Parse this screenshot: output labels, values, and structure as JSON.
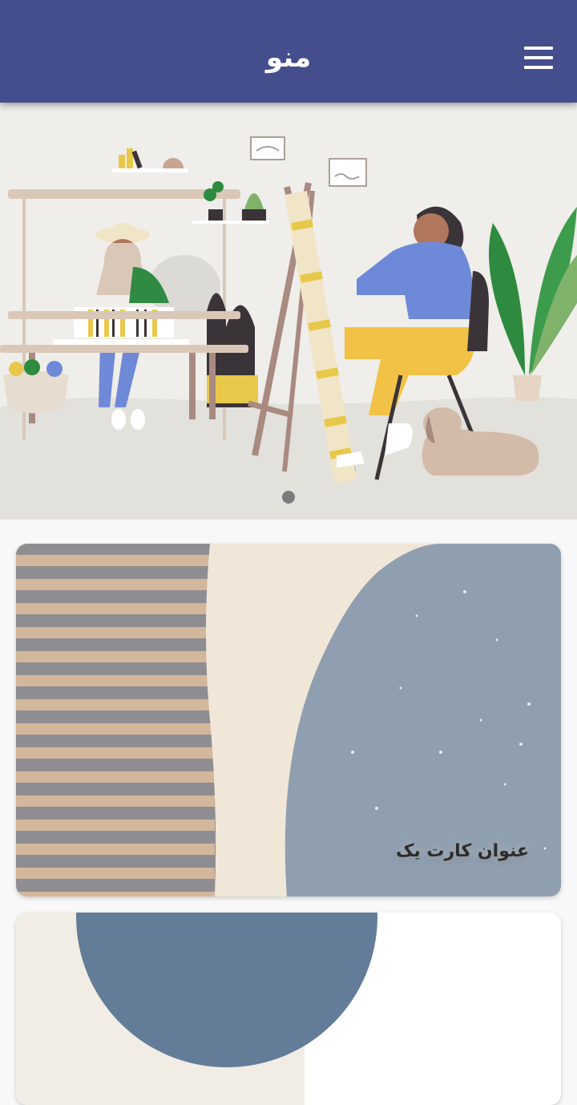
{
  "appbar": {
    "title": "منو",
    "menu_icon": "hamburger-menu-icon",
    "background": "#454e8c"
  },
  "carousel": {
    "slide_image": "illustration-artist-painting-and-weaver",
    "active_index": 0,
    "dot_count": 1
  },
  "cards": [
    {
      "title": "عنوان کارت یک",
      "image": "abstract-stripes-and-blue-shape"
    },
    {
      "title": "",
      "image": "abstract-blue-circle"
    }
  ]
}
